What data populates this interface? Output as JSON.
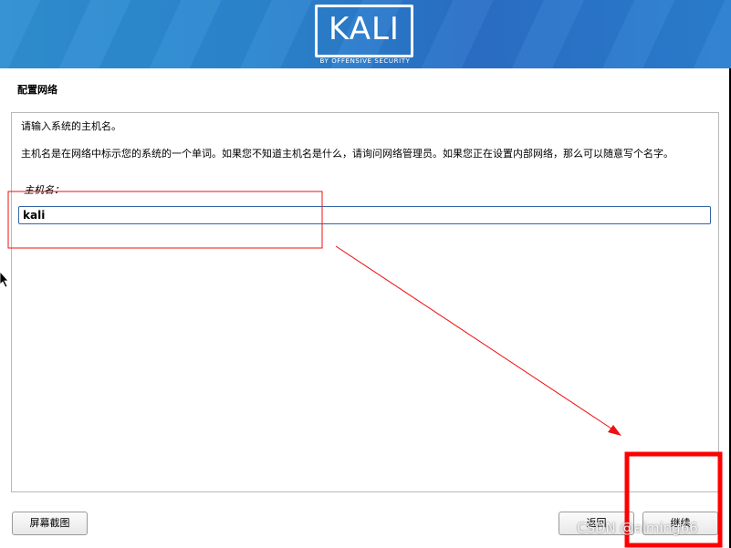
{
  "banner": {
    "logo_text": "KALI",
    "logo_subtitle": "BY OFFENSIVE SECURITY"
  },
  "step": {
    "title": "配置网络"
  },
  "form": {
    "prompt": "请输入系统的主机名。",
    "description": "主机名是在网络中标示您的系统的一个单词。如果您不知道主机名是什么，请询问网络管理员。如果您正在设置内部网络，那么可以随意写个名字。",
    "hostname_label": "主机名：",
    "hostname_value": "kali"
  },
  "buttons": {
    "screenshot": "屏幕截图",
    "back": "返回",
    "continue": "继续"
  },
  "annotations": {
    "highlight_color": "#ff0000",
    "watermark": "CSDN @aiming66"
  },
  "colors": {
    "banner_blue": "#2a7fd0",
    "input_border": "#3465a4"
  }
}
